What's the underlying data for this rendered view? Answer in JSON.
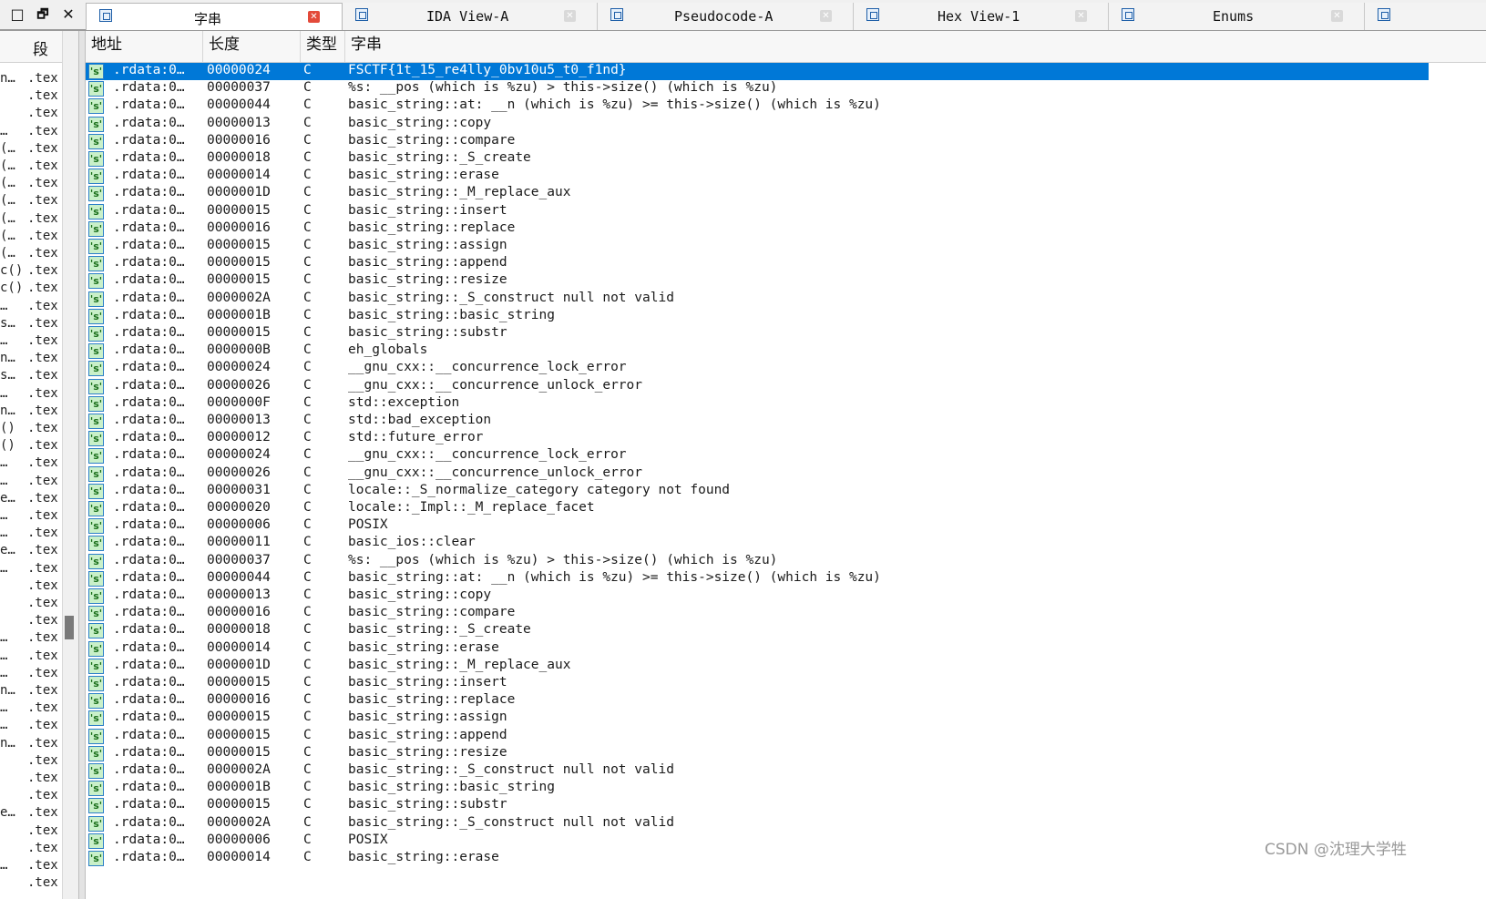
{
  "window_controls": [
    "□",
    "🗗",
    "✕"
  ],
  "tabs": [
    {
      "label": "字串",
      "active": true,
      "close": "✕"
    },
    {
      "label": "IDA View-A",
      "active": false,
      "close": "✕"
    },
    {
      "label": "Pseudocode-A",
      "active": false,
      "close": "✕"
    },
    {
      "label": "Hex View-1",
      "active": false,
      "close": "✕"
    },
    {
      "label": "Enums",
      "active": false,
      "close": "✕"
    }
  ],
  "left_pane": {
    "header": "段",
    "rows": [
      {
        "frag": "n…",
        "seg": ".tex"
      },
      {
        "frag": "",
        "seg": ".tex"
      },
      {
        "frag": "",
        "seg": ".tex"
      },
      {
        "frag": "…",
        "seg": ".tex"
      },
      {
        "frag": "(…",
        "seg": ".tex"
      },
      {
        "frag": "(…",
        "seg": ".tex"
      },
      {
        "frag": "(…",
        "seg": ".tex"
      },
      {
        "frag": "(…",
        "seg": ".tex"
      },
      {
        "frag": "(…",
        "seg": ".tex"
      },
      {
        "frag": "(…",
        "seg": ".tex"
      },
      {
        "frag": "(…",
        "seg": ".tex"
      },
      {
        "frag": "c()",
        "seg": ".tex"
      },
      {
        "frag": "c()",
        "seg": ".tex"
      },
      {
        "frag": "…",
        "seg": ".tex"
      },
      {
        "frag": "s…",
        "seg": ".tex"
      },
      {
        "frag": "…",
        "seg": ".tex"
      },
      {
        "frag": "n…",
        "seg": ".tex"
      },
      {
        "frag": "s…",
        "seg": ".tex"
      },
      {
        "frag": "…",
        "seg": ".tex"
      },
      {
        "frag": "n…",
        "seg": ".tex"
      },
      {
        "frag": "()",
        "seg": ".tex"
      },
      {
        "frag": "()",
        "seg": ".tex"
      },
      {
        "frag": "…",
        "seg": ".tex"
      },
      {
        "frag": "…",
        "seg": ".tex"
      },
      {
        "frag": "e…",
        "seg": ".tex"
      },
      {
        "frag": "…",
        "seg": ".tex"
      },
      {
        "frag": "…",
        "seg": ".tex"
      },
      {
        "frag": "e…",
        "seg": ".tex"
      },
      {
        "frag": "…",
        "seg": ".tex"
      },
      {
        "frag": "",
        "seg": ".tex"
      },
      {
        "frag": "",
        "seg": ".tex"
      },
      {
        "frag": "",
        "seg": ".tex"
      },
      {
        "frag": "…",
        "seg": ".tex"
      },
      {
        "frag": "…",
        "seg": ".tex"
      },
      {
        "frag": "…",
        "seg": ".tex"
      },
      {
        "frag": "n…",
        "seg": ".tex"
      },
      {
        "frag": "…",
        "seg": ".tex"
      },
      {
        "frag": "…",
        "seg": ".tex"
      },
      {
        "frag": "n…",
        "seg": ".tex"
      },
      {
        "frag": "",
        "seg": ".tex"
      },
      {
        "frag": "",
        "seg": ".tex"
      },
      {
        "frag": "",
        "seg": ".tex"
      },
      {
        "frag": "e…",
        "seg": ".tex"
      },
      {
        "frag": "",
        "seg": ".tex"
      },
      {
        "frag": "",
        "seg": ".tex"
      },
      {
        "frag": "…",
        "seg": ".tex"
      },
      {
        "frag": "",
        "seg": ".tex"
      }
    ]
  },
  "table": {
    "columns": [
      "地址",
      "长度",
      "类型",
      "字串"
    ],
    "icon_glyph": "'s'",
    "rows": [
      {
        "addr": ".rdata:0…",
        "len": "00000024",
        "type": "C",
        "str": "FSCTF{1t_15_re4lly_0bv10u5_t0_f1nd}",
        "selected": true
      },
      {
        "addr": ".rdata:0…",
        "len": "00000037",
        "type": "C",
        "str": "%s: __pos (which is %zu) > this->size() (which is %zu)"
      },
      {
        "addr": ".rdata:0…",
        "len": "00000044",
        "type": "C",
        "str": "basic_string::at: __n (which is %zu) >= this->size() (which is %zu)"
      },
      {
        "addr": ".rdata:0…",
        "len": "00000013",
        "type": "C",
        "str": "basic_string::copy"
      },
      {
        "addr": ".rdata:0…",
        "len": "00000016",
        "type": "C",
        "str": "basic_string::compare"
      },
      {
        "addr": ".rdata:0…",
        "len": "00000018",
        "type": "C",
        "str": "basic_string::_S_create"
      },
      {
        "addr": ".rdata:0…",
        "len": "00000014",
        "type": "C",
        "str": "basic_string::erase"
      },
      {
        "addr": ".rdata:0…",
        "len": "0000001D",
        "type": "C",
        "str": "basic_string::_M_replace_aux"
      },
      {
        "addr": ".rdata:0…",
        "len": "00000015",
        "type": "C",
        "str": "basic_string::insert"
      },
      {
        "addr": ".rdata:0…",
        "len": "00000016",
        "type": "C",
        "str": "basic_string::replace"
      },
      {
        "addr": ".rdata:0…",
        "len": "00000015",
        "type": "C",
        "str": "basic_string::assign"
      },
      {
        "addr": ".rdata:0…",
        "len": "00000015",
        "type": "C",
        "str": "basic_string::append"
      },
      {
        "addr": ".rdata:0…",
        "len": "00000015",
        "type": "C",
        "str": "basic_string::resize"
      },
      {
        "addr": ".rdata:0…",
        "len": "0000002A",
        "type": "C",
        "str": "basic_string::_S_construct null not valid"
      },
      {
        "addr": ".rdata:0…",
        "len": "0000001B",
        "type": "C",
        "str": "basic_string::basic_string"
      },
      {
        "addr": ".rdata:0…",
        "len": "00000015",
        "type": "C",
        "str": "basic_string::substr"
      },
      {
        "addr": ".rdata:0…",
        "len": "0000000B",
        "type": "C",
        "str": "eh_globals"
      },
      {
        "addr": ".rdata:0…",
        "len": "00000024",
        "type": "C",
        "str": "__gnu_cxx::__concurrence_lock_error"
      },
      {
        "addr": ".rdata:0…",
        "len": "00000026",
        "type": "C",
        "str": "__gnu_cxx::__concurrence_unlock_error"
      },
      {
        "addr": ".rdata:0…",
        "len": "0000000F",
        "type": "C",
        "str": "std::exception"
      },
      {
        "addr": ".rdata:0…",
        "len": "00000013",
        "type": "C",
        "str": "std::bad_exception"
      },
      {
        "addr": ".rdata:0…",
        "len": "00000012",
        "type": "C",
        "str": "std::future_error"
      },
      {
        "addr": ".rdata:0…",
        "len": "00000024",
        "type": "C",
        "str": "__gnu_cxx::__concurrence_lock_error"
      },
      {
        "addr": ".rdata:0…",
        "len": "00000026",
        "type": "C",
        "str": "__gnu_cxx::__concurrence_unlock_error"
      },
      {
        "addr": ".rdata:0…",
        "len": "00000031",
        "type": "C",
        "str": "locale::_S_normalize_category category not found"
      },
      {
        "addr": ".rdata:0…",
        "len": "00000020",
        "type": "C",
        "str": "locale::_Impl::_M_replace_facet"
      },
      {
        "addr": ".rdata:0…",
        "len": "00000006",
        "type": "C",
        "str": "POSIX"
      },
      {
        "addr": ".rdata:0…",
        "len": "00000011",
        "type": "C",
        "str": "basic_ios::clear"
      },
      {
        "addr": ".rdata:0…",
        "len": "00000037",
        "type": "C",
        "str": "%s: __pos (which is %zu) > this->size() (which is %zu)"
      },
      {
        "addr": ".rdata:0…",
        "len": "00000044",
        "type": "C",
        "str": "basic_string::at: __n (which is %zu) >= this->size() (which is %zu)"
      },
      {
        "addr": ".rdata:0…",
        "len": "00000013",
        "type": "C",
        "str": "basic_string::copy"
      },
      {
        "addr": ".rdata:0…",
        "len": "00000016",
        "type": "C",
        "str": "basic_string::compare"
      },
      {
        "addr": ".rdata:0…",
        "len": "00000018",
        "type": "C",
        "str": "basic_string::_S_create"
      },
      {
        "addr": ".rdata:0…",
        "len": "00000014",
        "type": "C",
        "str": "basic_string::erase"
      },
      {
        "addr": ".rdata:0…",
        "len": "0000001D",
        "type": "C",
        "str": "basic_string::_M_replace_aux"
      },
      {
        "addr": ".rdata:0…",
        "len": "00000015",
        "type": "C",
        "str": "basic_string::insert"
      },
      {
        "addr": ".rdata:0…",
        "len": "00000016",
        "type": "C",
        "str": "basic_string::replace"
      },
      {
        "addr": ".rdata:0…",
        "len": "00000015",
        "type": "C",
        "str": "basic_string::assign"
      },
      {
        "addr": ".rdata:0…",
        "len": "00000015",
        "type": "C",
        "str": "basic_string::append"
      },
      {
        "addr": ".rdata:0…",
        "len": "00000015",
        "type": "C",
        "str": "basic_string::resize"
      },
      {
        "addr": ".rdata:0…",
        "len": "0000002A",
        "type": "C",
        "str": "basic_string::_S_construct null not valid"
      },
      {
        "addr": ".rdata:0…",
        "len": "0000001B",
        "type": "C",
        "str": "basic_string::basic_string"
      },
      {
        "addr": ".rdata:0…",
        "len": "00000015",
        "type": "C",
        "str": "basic_string::substr"
      },
      {
        "addr": ".rdata:0…",
        "len": "0000002A",
        "type": "C",
        "str": "basic_string::_S_construct null not valid"
      },
      {
        "addr": ".rdata:0…",
        "len": "00000006",
        "type": "C",
        "str": "POSIX"
      },
      {
        "addr": ".rdata:0…",
        "len": "00000014",
        "type": "C",
        "str": "basic_string::erase"
      }
    ]
  },
  "watermark": "CSDN @沈理大学牲",
  "colors": {
    "selection": "#0078d7",
    "tab_close_active": "#e34a3a"
  }
}
